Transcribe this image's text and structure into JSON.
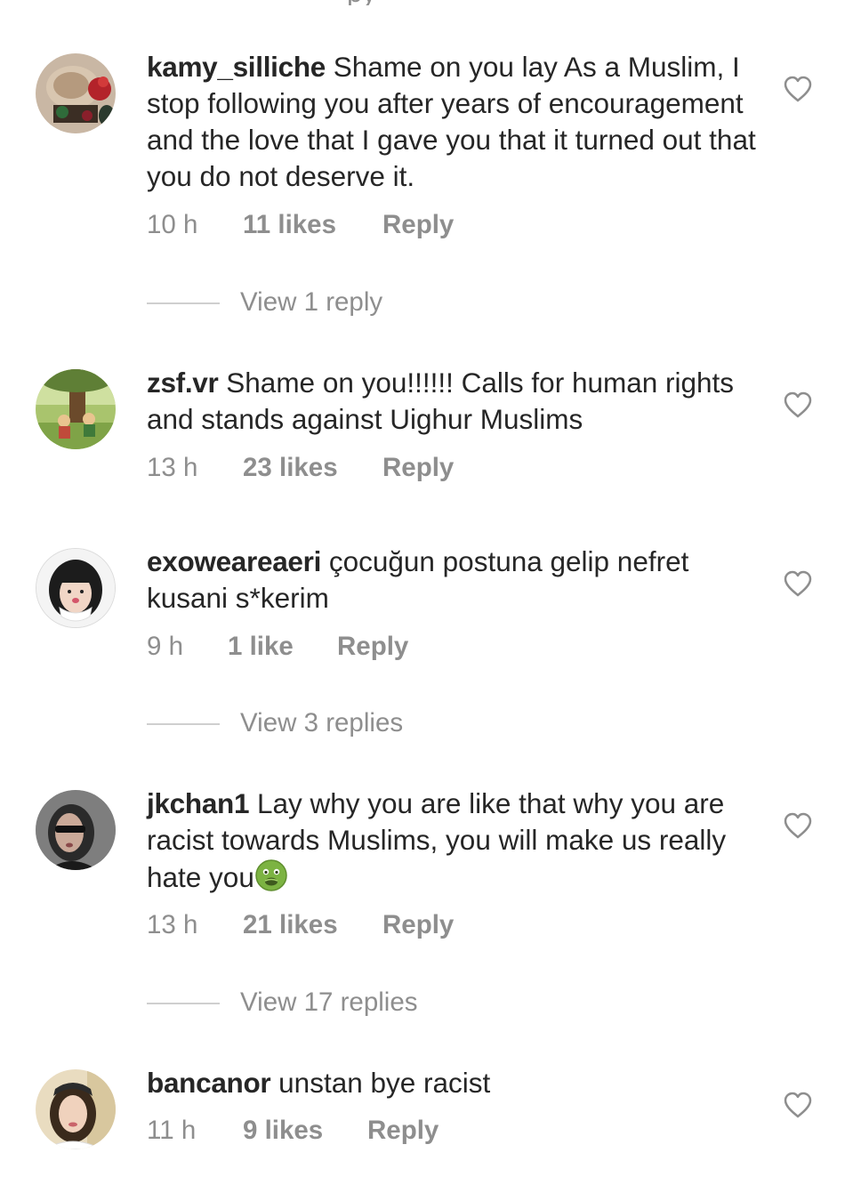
{
  "comments": [
    {
      "username": "kamy_silliche",
      "text": "Shame on you lay As a Muslim, I stop following you after years of encouragement and the love that I gave you that it turned out that you do not deserve it.",
      "time": "10 h",
      "likes": "11 likes",
      "reply": "Reply",
      "view_replies": "View 1 reply"
    },
    {
      "username": "zsf.vr",
      "text": "Shame on you!!!!!! Calls for human rights and stands against Uighur Muslims",
      "time": "13 h",
      "likes": "23 likes",
      "reply": "Reply"
    },
    {
      "username": "exoweareaeri",
      "text": "çocuğun postuna gelip nefret kusani s*kerim",
      "time": "9 h",
      "likes": "1 like",
      "reply": "Reply",
      "view_replies": "View 3 replies"
    },
    {
      "username": "jkchan1",
      "text": "Lay why you are like that why you are racist towards Muslims, you will make us really hate you",
      "emoji": "nauseated-face-emoji",
      "time": "13 h",
      "likes": "21 likes",
      "reply": "Reply",
      "view_replies": "View 17 replies"
    },
    {
      "username": "bancanor",
      "text": "unstan bye racist",
      "time": "11 h",
      "likes": "9 likes",
      "reply": "Reply"
    }
  ],
  "icons": {
    "like": "heart-outline-icon"
  },
  "colors": {
    "primary_text": "#262626",
    "secondary_text": "#8e8e8e",
    "divider": "#cfcfcf",
    "background": "#ffffff"
  }
}
